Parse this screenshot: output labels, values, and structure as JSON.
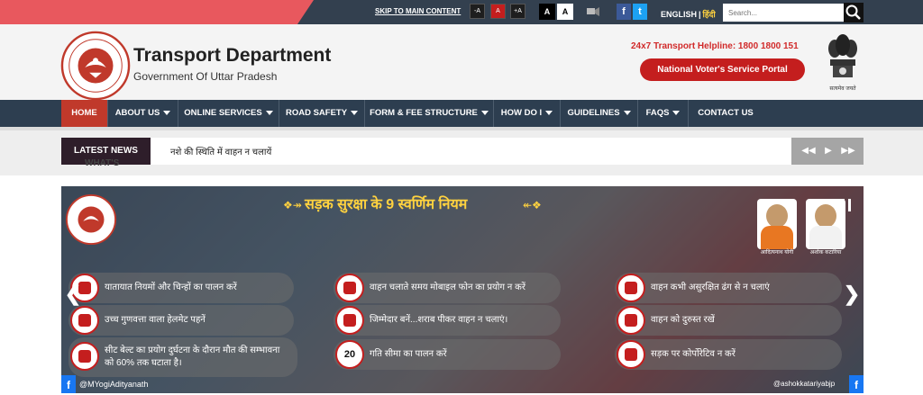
{
  "topbar": {
    "skip_link": "SKIP TO MAIN CONTENT",
    "font_buttons": [
      "-A",
      "A",
      "+A"
    ],
    "contrast_buttons": [
      "A",
      "A"
    ],
    "social": {
      "facebook": "f",
      "twitter": "t"
    },
    "lang_english": "ENGLISH",
    "lang_sep": "|",
    "lang_hindi": "हिंदी",
    "search_placeholder": "Search..."
  },
  "header": {
    "title": "Transport Department",
    "subtitle": "Government Of Uttar Pradesh",
    "helpline": "24x7 Transport Helpline: 1800 1800 151",
    "voter_portal": "National Voter's Service Portal",
    "emblem_caption": "सत्यमेव जयते"
  },
  "nav": {
    "items": [
      {
        "label": "HOME",
        "dropdown": false
      },
      {
        "label": "ABOUT US",
        "dropdown": true
      },
      {
        "label": "ONLINE SERVICES",
        "dropdown": true
      },
      {
        "label": "ROAD SAFETY",
        "dropdown": true
      },
      {
        "label": "FORM & FEE STRUCTURE",
        "dropdown": true
      },
      {
        "label": "HOW DO I",
        "dropdown": true
      },
      {
        "label": "GUIDELINES",
        "dropdown": true
      },
      {
        "label": "FAQS",
        "dropdown": true
      },
      {
        "label": "CONTACT US",
        "dropdown": false
      }
    ]
  },
  "news": {
    "label": "LATEST NEWS",
    "ticker": "नशे की स्थिति में वाहन न चलायें",
    "whats_partial": "WHAT'S"
  },
  "banner": {
    "title": "सड़क सुरक्षा के 9 स्वर्णिम नियम",
    "leaders": [
      "आदित्यनाथ योगी",
      "अशोक कटारिया"
    ],
    "rules": [
      "यातायात नियमों और चिन्हों का पालन करें",
      "उच्च गुणवत्ता वाला हेलमेट पहनें",
      "सीट बेल्ट का प्रयोग दुर्घटना के दौरान मौत की सम्भावना को 60% तक घटाता है।",
      "वाहन चलाते समय मोबाइल फोन का प्रयोग न करें",
      "जिम्मेदार बनें...शराब पीकर वाहन न चलाएं।",
      "गति सीमा का पालन करें",
      "वाहन कभी असुरक्षित ढंग से न चलाएं",
      "वाहन को दुरुस्त रखें",
      "सड़क पर कोर्पोरेटिव न करें"
    ],
    "speed_sign": "20",
    "fb_left": "@MYogiAdityanath",
    "fb_right": "@ashokkatariyabjp"
  },
  "colors": {
    "topbar": "#33404f",
    "accent_red": "#c41e1e",
    "nav": "#2d3e50",
    "helpline": "#d12a2a"
  }
}
